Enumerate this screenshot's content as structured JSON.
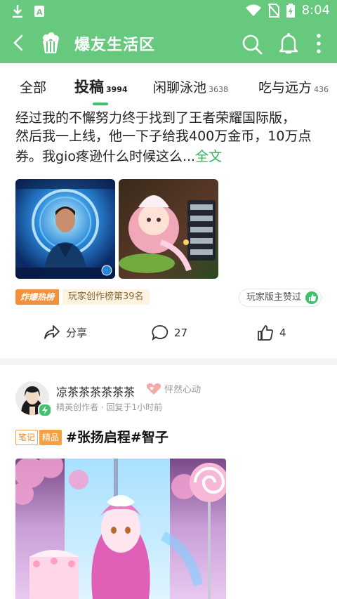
{
  "status_bar": {
    "time": "8:04"
  },
  "app_bar": {
    "title": "爆友生活区"
  },
  "tabs": [
    {
      "label": "全部",
      "count": ""
    },
    {
      "label": "投稿",
      "count": "3994"
    },
    {
      "label": "闲聊泳池",
      "count": "3638"
    },
    {
      "label": "吃与远方",
      "count": "436"
    }
  ],
  "post1": {
    "text_clipped": "经过我的不懈努力终于找到了王者荣耀国际版，",
    "text_line2": "然后我一上线，他一下子给我400万金币，10万点",
    "text_line3": "券。我gio疼逊什么时候这么...",
    "more_link": "全文",
    "hot_tag": "炸爆热榜",
    "rank_tag": "玩家创作榜第39名",
    "praise": "玩家版主赞过",
    "share_label": "分享",
    "comment_count": "27",
    "like_count": "4"
  },
  "post2": {
    "username": "凉茶茶茶茶茶茶",
    "mood": "怦然心动",
    "subline": "精英创作者 · 回复于1小时前",
    "tag_note": "笔记",
    "tag_fine": "精品",
    "title": "#张扬启程#智子"
  },
  "colors": {
    "brand": "#66c97e",
    "accent": "#2db55d",
    "hot": "#f4903b"
  }
}
